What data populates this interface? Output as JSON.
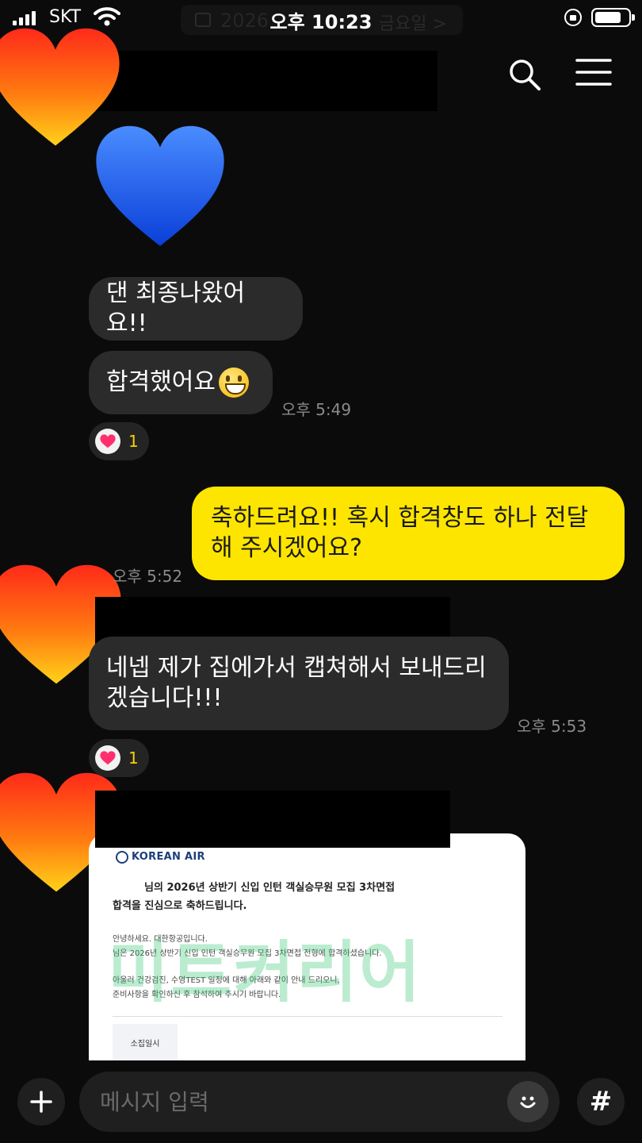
{
  "status_bar": {
    "carrier": "SKT",
    "time": "오후 10:23",
    "date_partial": "2026",
    "day_partial": "금요일 >"
  },
  "messages": [
    {
      "id": "m1",
      "sender": "other",
      "text": "댄 최종나왔어요!!"
    },
    {
      "id": "m2",
      "sender": "other",
      "text": "합격했어요",
      "emoji": "grinning-face",
      "time": "오후 5:49",
      "reaction_count": "1"
    },
    {
      "id": "m3",
      "sender": "me",
      "text": "축하드려요!! 혹시 합격창도 하나 전달해 주시겠어요?",
      "time": "오후 5:52"
    },
    {
      "id": "m4",
      "sender": "other",
      "text": "네넵 제가 집에가서 캡쳐해서 보내드리 겠습니다!!!",
      "time": "오후 5:53",
      "reaction_count": "1"
    }
  ],
  "image_message": {
    "logo": "KOREAN AIR",
    "title_line1": "님의 2026년 상반기 신입 인턴 객실승무원 모집 3차면접",
    "title_line2": "합격을 진심으로 축하드립니다.",
    "greeting": "안녕하세요. 대한항공입니다.",
    "body1": "님은 2026년 상반기 신입 인턴 객실승무원 모집 3차면접 전형에 합격하셨습니다.",
    "body2": "아울러 건강검진, 수영TEST 일정에 대해 아래와 같이 안내 드리오니,",
    "body3": "준비사항을 확인하신 후 참석하여 주시기 바랍니다.",
    "watermark": "미트커리어",
    "table_header": "소집일시"
  },
  "input": {
    "placeholder": "메시지 입력"
  },
  "icons": {
    "search": "search-icon",
    "menu": "menu-icon",
    "plus": "plus-icon",
    "emoji": "emoji-icon",
    "hashtag": "hashtag-icon"
  },
  "colors": {
    "background": "#0b0b0b",
    "other_bubble": "#2b2b2b",
    "my_bubble": "#fee500",
    "time_text": "#8a8a8a",
    "reaction_count": "#f5d200"
  }
}
